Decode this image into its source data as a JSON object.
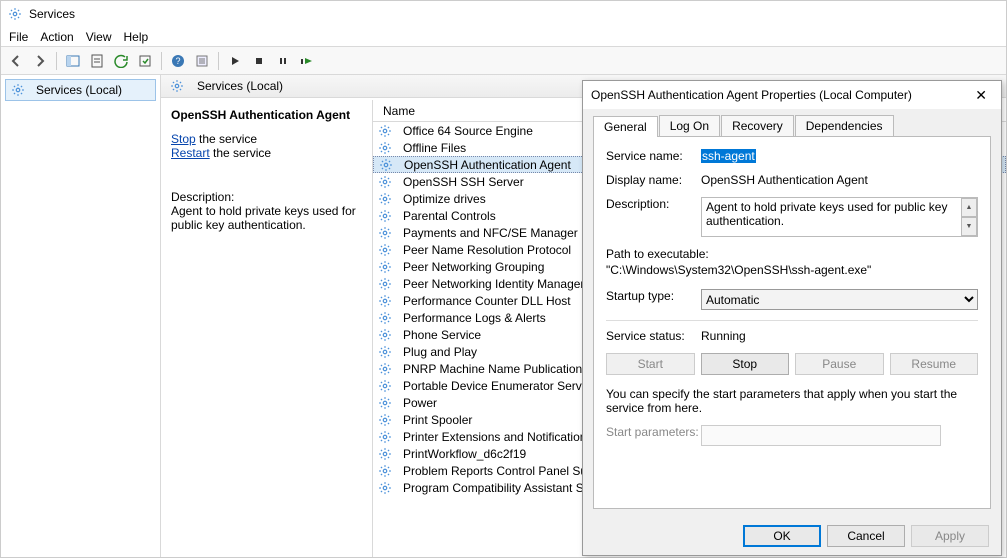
{
  "title": "Services",
  "menu": {
    "file": "File",
    "action": "Action",
    "view": "View",
    "help": "Help"
  },
  "tree": {
    "root": "Services (Local)"
  },
  "panel_header": "Services (Local)",
  "detail": {
    "selected_name": "OpenSSH Authentication Agent",
    "stop_link": "Stop",
    "stop_suffix": " the service",
    "restart_link": "Restart",
    "restart_suffix": " the service",
    "desc_label": "Description:",
    "desc_text": "Agent to hold private keys used for public key authentication."
  },
  "column_name": "Name",
  "services": [
    "Office 64 Source Engine",
    "Offline Files",
    "OpenSSH Authentication Agent",
    "OpenSSH SSH Server",
    "Optimize drives",
    "Parental Controls",
    "Payments and NFC/SE Manager",
    "Peer Name Resolution Protocol",
    "Peer Networking Grouping",
    "Peer Networking Identity Manager",
    "Performance Counter DLL Host",
    "Performance Logs & Alerts",
    "Phone Service",
    "Plug and Play",
    "PNRP Machine Name Publication Servic",
    "Portable Device Enumerator Service",
    "Power",
    "Print Spooler",
    "Printer Extensions and Notifications",
    "PrintWorkflow_d6c2f19",
    "Problem Reports Control Panel Support",
    "Program Compatibility Assistant Servic"
  ],
  "selected_index": 2,
  "dialog": {
    "title": "OpenSSH Authentication Agent Properties (Local Computer)",
    "tabs": {
      "general": "General",
      "logon": "Log On",
      "recovery": "Recovery",
      "dependencies": "Dependencies"
    },
    "labels": {
      "service_name": "Service name:",
      "display_name": "Display name:",
      "description": "Description:",
      "path_label": "Path to executable:",
      "startup_type": "Startup type:",
      "service_status": "Service status:",
      "hint": "You can specify the start parameters that apply when you start the service from here.",
      "start_params": "Start parameters:"
    },
    "values": {
      "service_name": "ssh-agent",
      "display_name": "OpenSSH Authentication Agent",
      "description": "Agent to hold private keys used for public key authentication.",
      "path": "\"C:\\Windows\\System32\\OpenSSH\\ssh-agent.exe\"",
      "startup_type": "Automatic",
      "status": "Running"
    },
    "buttons": {
      "start": "Start",
      "stop": "Stop",
      "pause": "Pause",
      "resume": "Resume",
      "ok": "OK",
      "cancel": "Cancel",
      "apply": "Apply"
    }
  }
}
